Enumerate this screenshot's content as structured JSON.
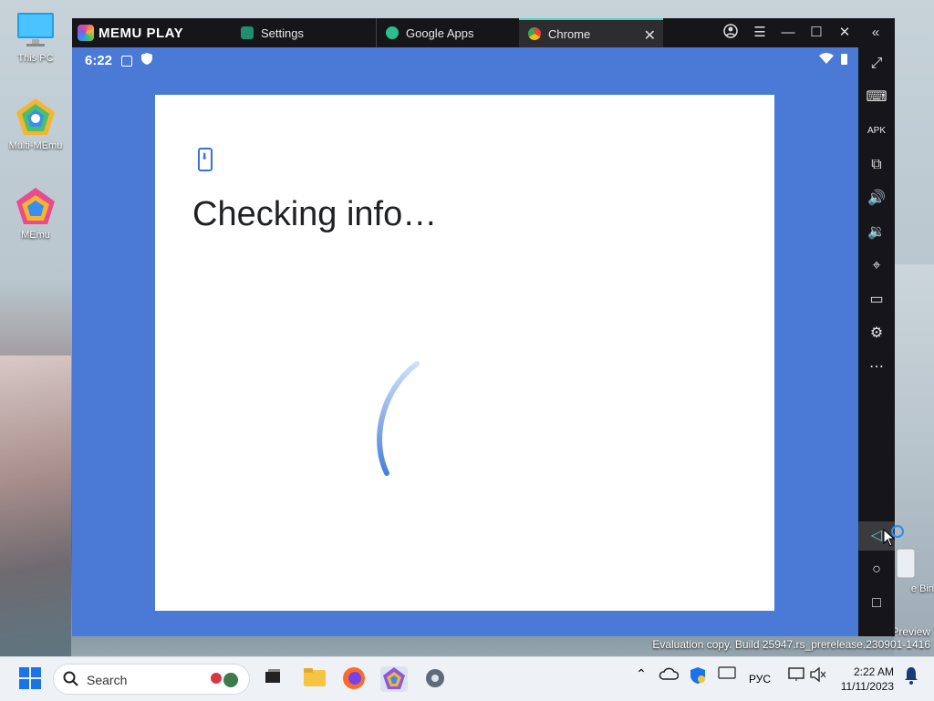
{
  "desktop": {
    "icons": [
      {
        "label": "This PC"
      },
      {
        "label": "Multi-MEmu"
      },
      {
        "label": "MEmu"
      }
    ],
    "recycle_label": "e Bin",
    "preview_text": "Preview",
    "evaluation_text": "Evaluation copy. Build 25947.rs_prerelease.230901-1416"
  },
  "emulator": {
    "brand": "MEMU PLAY",
    "tabs": [
      {
        "label": "Settings"
      },
      {
        "label": "Google Apps"
      },
      {
        "label": "Chrome",
        "close": "✕"
      }
    ],
    "status_time": "6:22",
    "accent_color": "#4dd6c1"
  },
  "content": {
    "title": "Checking info…"
  },
  "taskbar": {
    "search_placeholder": "Search",
    "language": "РУС",
    "time": "2:22 AM",
    "date": "11/11/2023"
  }
}
